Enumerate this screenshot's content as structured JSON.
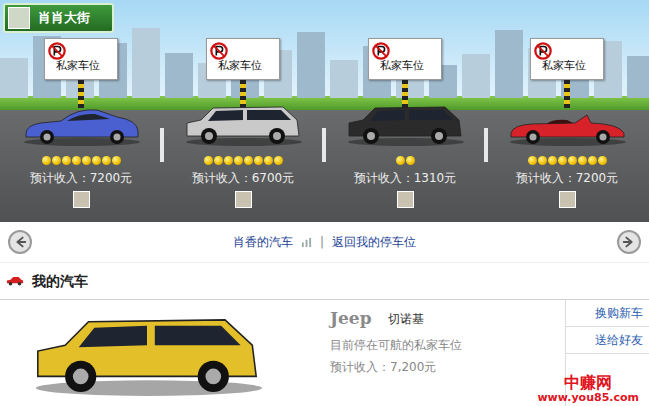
{
  "street": {
    "title": "肖肖大街"
  },
  "spots": [
    {
      "sign": "私家车位",
      "kind": "sports",
      "color": "#4a5fd0",
      "coins": 8,
      "income": "预计收入：7200元"
    },
    {
      "sign": "私家车位",
      "kind": "suv",
      "color": "#c9c9c9",
      "coins": 8,
      "income": "预计收入：6700元"
    },
    {
      "sign": "私家车位",
      "kind": "suv",
      "color": "#2b2b2b",
      "coins": 2,
      "income": "预计收入：1310元"
    },
    {
      "sign": "私家车位",
      "kind": "convertible",
      "color": "#d8222a",
      "coins": 8,
      "income": "预计收入：7200元"
    }
  ],
  "nav": {
    "owner": "肖香的汽车",
    "separator": "|",
    "back": "返回我的停车位"
  },
  "my_car": {
    "heading": "我的汽车",
    "kind": "suv",
    "color": "#e3bf2a",
    "brand": "Jeep",
    "model": "切诺基",
    "location": "目前停在可航的私家车位",
    "income": "预计收入：7,200元",
    "actions": [
      "换购新车",
      "送给好友"
    ]
  },
  "watermark": {
    "name": "中赚网",
    "url": "www.you85.com"
  }
}
